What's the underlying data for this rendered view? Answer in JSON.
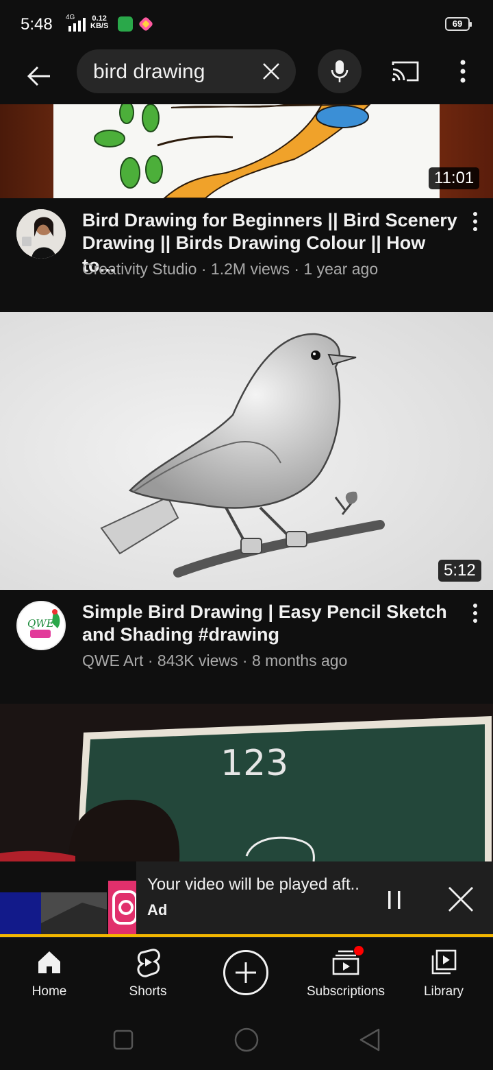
{
  "status_bar": {
    "time": "5:48",
    "network": "4G",
    "speed_value": "0.12",
    "speed_unit": "KB/S",
    "battery": "69"
  },
  "search": {
    "query": "bird drawing"
  },
  "videos": [
    {
      "duration": "11:01",
      "title": "Bird Drawing for Beginners || Bird Scenery Drawing || Birds Drawing Colour || How to...",
      "channel": "Creativity Studio",
      "views": "1.2M views",
      "age": "1 year ago"
    },
    {
      "duration": "5:12",
      "title": "Simple Bird Drawing | Easy Pencil Sketch and Shading #drawing",
      "channel": "QWE Art",
      "views": "843K views",
      "age": "8 months ago"
    },
    {
      "board_text": "123"
    }
  ],
  "mini_player": {
    "title": "Your video will be played aft..",
    "badge": "Ad",
    "progress": 1.0
  },
  "bottom_nav": {
    "items": [
      {
        "label": "Home",
        "icon": "home-icon"
      },
      {
        "label": "Shorts",
        "icon": "shorts-icon"
      },
      {
        "label": "",
        "icon": "create-plus-icon"
      },
      {
        "label": "Subscriptions",
        "icon": "subscriptions-icon"
      },
      {
        "label": "Library",
        "icon": "library-icon"
      }
    ]
  },
  "colors": {
    "background": "#0f0f0f",
    "search_bg": "#272727",
    "secondary_text": "#aaaaaa",
    "progress": "#f2b600",
    "notification": "#ff0000"
  }
}
